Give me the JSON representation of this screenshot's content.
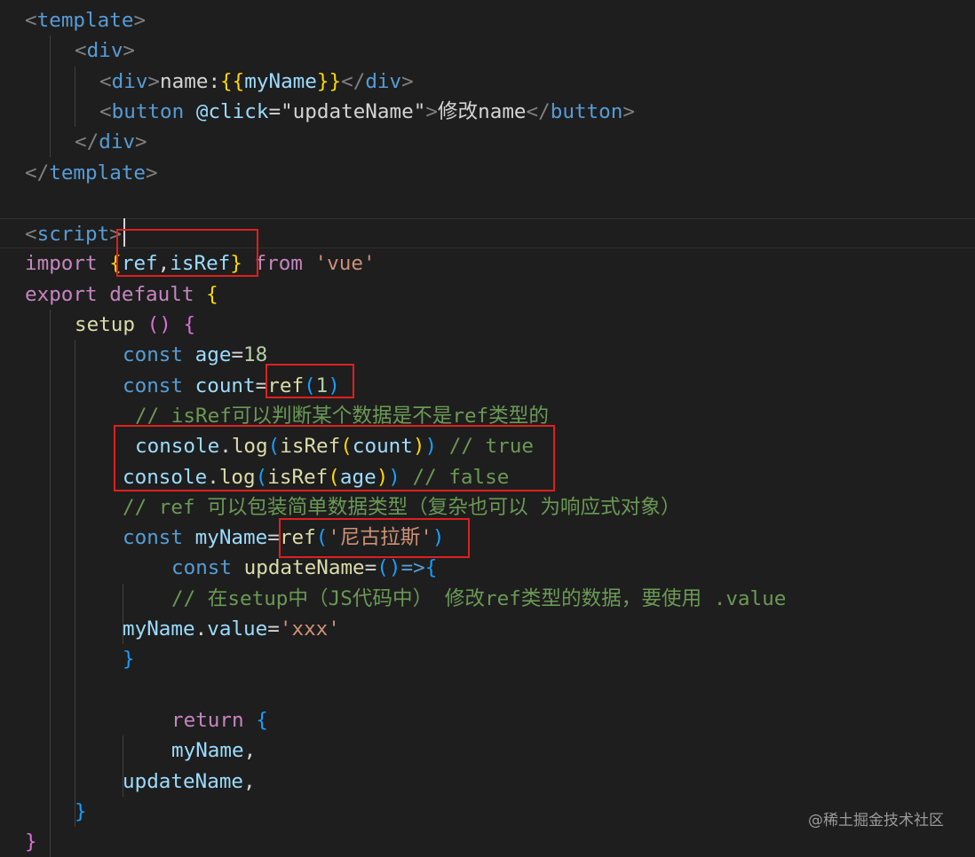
{
  "editor": {
    "lines": [
      {
        "tokens": [
          {
            "t": "<",
            "c": "punct"
          },
          {
            "t": "template",
            "c": "tag"
          },
          {
            "t": ">",
            "c": "punct"
          }
        ]
      },
      {
        "tokens": [
          {
            "t": "<",
            "c": "punct"
          },
          {
            "t": "div",
            "c": "tag"
          },
          {
            "t": ">",
            "c": "punct"
          }
        ]
      },
      {
        "tokens": [
          {
            "t": "<",
            "c": "punct"
          },
          {
            "t": "div",
            "c": "tag"
          },
          {
            "t": ">",
            "c": "punct"
          },
          {
            "t": "name:",
            "c": "plain"
          },
          {
            "t": "{{",
            "c": "b1"
          },
          {
            "t": "myName",
            "c": "var"
          },
          {
            "t": "}}",
            "c": "b1"
          },
          {
            "t": "</",
            "c": "punct"
          },
          {
            "t": "div",
            "c": "tag"
          },
          {
            "t": ">",
            "c": "punct"
          }
        ]
      },
      {
        "tokens": [
          {
            "t": "<",
            "c": "punct"
          },
          {
            "t": "button",
            "c": "tag"
          },
          {
            "t": " ",
            "c": "plain"
          },
          {
            "t": "@click",
            "c": "attr"
          },
          {
            "t": "=",
            "c": "plain"
          },
          {
            "t": "\"updateName\"",
            "c": "plain"
          },
          {
            "t": ">",
            "c": "punct"
          },
          {
            "t": "修改name",
            "c": "plain"
          },
          {
            "t": "</",
            "c": "punct"
          },
          {
            "t": "button",
            "c": "tag"
          },
          {
            "t": ">",
            "c": "punct"
          }
        ]
      },
      {
        "tokens": [
          {
            "t": "</",
            "c": "punct"
          },
          {
            "t": "div",
            "c": "tag"
          },
          {
            "t": ">",
            "c": "punct"
          }
        ]
      },
      {
        "tokens": [
          {
            "t": "</",
            "c": "punct"
          },
          {
            "t": "template",
            "c": "tag"
          },
          {
            "t": ">",
            "c": "punct"
          }
        ]
      },
      {
        "tokens": []
      },
      {
        "tokens": [
          {
            "t": "<",
            "c": "punct"
          },
          {
            "t": "script",
            "c": "tag"
          },
          {
            "t": ">",
            "c": "punct"
          }
        ]
      },
      {
        "tokens": [
          {
            "t": "import",
            "c": "kw"
          },
          {
            "t": " ",
            "c": "plain"
          },
          {
            "t": "{",
            "c": "b1"
          },
          {
            "t": "ref",
            "c": "var"
          },
          {
            "t": ",",
            "c": "plain"
          },
          {
            "t": "isRef",
            "c": "var"
          },
          {
            "t": "}",
            "c": "b1"
          },
          {
            "t": " ",
            "c": "plain"
          },
          {
            "t": "from",
            "c": "kw"
          },
          {
            "t": " ",
            "c": "plain"
          },
          {
            "t": "'vue'",
            "c": "str"
          }
        ]
      },
      {
        "tokens": [
          {
            "t": "export",
            "c": "kw"
          },
          {
            "t": " ",
            "c": "plain"
          },
          {
            "t": "default",
            "c": "kw"
          },
          {
            "t": " ",
            "c": "plain"
          },
          {
            "t": "{",
            "c": "b1"
          }
        ]
      },
      {
        "tokens": [
          {
            "t": "setup",
            "c": "func"
          },
          {
            "t": " ",
            "c": "plain"
          },
          {
            "t": "()",
            "c": "b2"
          },
          {
            "t": " ",
            "c": "plain"
          },
          {
            "t": "{",
            "c": "b2"
          }
        ]
      },
      {
        "tokens": [
          {
            "t": "const",
            "c": "storage"
          },
          {
            "t": " ",
            "c": "plain"
          },
          {
            "t": "age",
            "c": "var"
          },
          {
            "t": "=",
            "c": "plain"
          },
          {
            "t": "18",
            "c": "num"
          }
        ]
      },
      {
        "tokens": [
          {
            "t": "const",
            "c": "storage"
          },
          {
            "t": " ",
            "c": "plain"
          },
          {
            "t": "count",
            "c": "var"
          },
          {
            "t": "=",
            "c": "plain"
          },
          {
            "t": "ref",
            "c": "func"
          },
          {
            "t": "(",
            "c": "b3"
          },
          {
            "t": "1",
            "c": "num"
          },
          {
            "t": ")",
            "c": "b3"
          }
        ]
      },
      {
        "tokens": [
          {
            "t": "// isRef可以判断某个数据是不是ref类型的",
            "c": "cmt"
          }
        ]
      },
      {
        "tokens": [
          {
            "t": "console",
            "c": "var"
          },
          {
            "t": ".",
            "c": "plain"
          },
          {
            "t": "log",
            "c": "func"
          },
          {
            "t": "(",
            "c": "b3"
          },
          {
            "t": "isRef",
            "c": "func"
          },
          {
            "t": "(",
            "c": "b1"
          },
          {
            "t": "count",
            "c": "var"
          },
          {
            "t": ")",
            "c": "b1"
          },
          {
            "t": ")",
            "c": "b3"
          },
          {
            "t": " // true",
            "c": "cmt"
          }
        ]
      },
      {
        "tokens": [
          {
            "t": "console",
            "c": "var"
          },
          {
            "t": ".",
            "c": "plain"
          },
          {
            "t": "log",
            "c": "func"
          },
          {
            "t": "(",
            "c": "b3"
          },
          {
            "t": "isRef",
            "c": "func"
          },
          {
            "t": "(",
            "c": "b1"
          },
          {
            "t": "age",
            "c": "var"
          },
          {
            "t": ")",
            "c": "b1"
          },
          {
            "t": ")",
            "c": "b3"
          },
          {
            "t": " // false",
            "c": "cmt"
          }
        ]
      },
      {
        "tokens": [
          {
            "t": "// ref 可以包装简单数据类型（复杂也可以 为响应式对象）",
            "c": "cmt"
          }
        ]
      },
      {
        "tokens": [
          {
            "t": "const",
            "c": "storage"
          },
          {
            "t": " ",
            "c": "plain"
          },
          {
            "t": "myName",
            "c": "var"
          },
          {
            "t": "=",
            "c": "plain"
          },
          {
            "t": "ref",
            "c": "func"
          },
          {
            "t": "(",
            "c": "b3"
          },
          {
            "t": "'尼古拉斯'",
            "c": "str"
          },
          {
            "t": ")",
            "c": "b3"
          }
        ]
      },
      {
        "tokens": [
          {
            "t": "const",
            "c": "storage"
          },
          {
            "t": " ",
            "c": "plain"
          },
          {
            "t": "updateName",
            "c": "func"
          },
          {
            "t": "=",
            "c": "plain"
          },
          {
            "t": "()",
            "c": "b3"
          },
          {
            "t": "=>",
            "c": "storage"
          },
          {
            "t": "{",
            "c": "b3"
          }
        ]
      },
      {
        "tokens": [
          {
            "t": "// 在setup中（JS代码中） 修改ref类型的数据，要使用 .value",
            "c": "cmt"
          }
        ]
      },
      {
        "tokens": [
          {
            "t": "myName",
            "c": "var"
          },
          {
            "t": ".",
            "c": "plain"
          },
          {
            "t": "value",
            "c": "var"
          },
          {
            "t": "=",
            "c": "plain"
          },
          {
            "t": "'xxx'",
            "c": "str"
          }
        ]
      },
      {
        "tokens": [
          {
            "t": "}",
            "c": "b3"
          }
        ]
      },
      {
        "tokens": []
      },
      {
        "tokens": [
          {
            "t": "return",
            "c": "kw"
          },
          {
            "t": " ",
            "c": "plain"
          },
          {
            "t": "{",
            "c": "b3"
          }
        ]
      },
      {
        "tokens": [
          {
            "t": "myName",
            "c": "var"
          },
          {
            "t": ",",
            "c": "plain"
          }
        ]
      },
      {
        "tokens": [
          {
            "t": "updateName",
            "c": "var"
          },
          {
            "t": ",",
            "c": "plain"
          }
        ]
      },
      {
        "tokens": [
          {
            "t": "}",
            "c": "b3"
          }
        ]
      },
      {
        "tokens": [
          {
            "t": "}",
            "c": "b2"
          }
        ]
      }
    ]
  },
  "watermark": "@稀土掘金技术社区",
  "colors": {
    "background": "#1e1e1e",
    "highlight_box": "#e01f1f"
  }
}
